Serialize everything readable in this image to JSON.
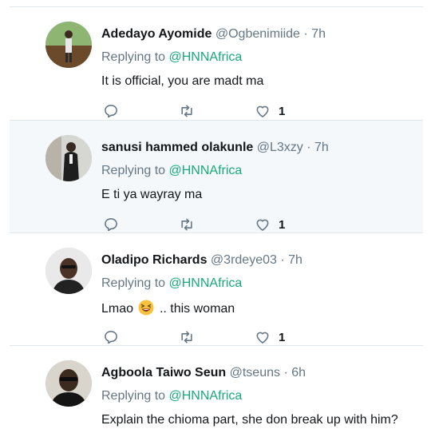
{
  "tweets": [
    {
      "name": "Adedayo Ayomide",
      "handle": "@Ogbenimiide",
      "dot": "·",
      "time": "7h",
      "replying_prefix": "Replying to",
      "replying_to": "@HNNAfrica",
      "text": "It is official, you are madt ma",
      "likes": "1",
      "highlighted": false
    },
    {
      "name": "sanusi hammed olakunle",
      "handle": "@L3xzy",
      "dot": "·",
      "time": "7h",
      "replying_prefix": "Replying to",
      "replying_to": "@HNNAfrica",
      "text": "E ti ya wayray ma",
      "likes": "1",
      "highlighted": true
    },
    {
      "name": "Oladipo Richards",
      "handle": "@3rdeye03",
      "dot": "·",
      "time": "7h",
      "replying_prefix": "Replying to",
      "replying_to": "@HNNAfrica",
      "text_before": "Lmao",
      "text_after": ".. this woman",
      "emoji": "laughing-face-emoji",
      "likes": "1",
      "highlighted": false
    },
    {
      "name": "Agboola Taiwo Seun",
      "handle": "@tseuns",
      "dot": "·",
      "time": "6h",
      "replying_prefix": "Replying to",
      "replying_to": "@HNNAfrica",
      "text": "Explain the chioma part, she don break up with him?",
      "highlighted": false
    }
  ],
  "colors": {
    "mention": "#19a97b",
    "divider": "#e1e8ed",
    "highlight_bg": "#f5f8fa",
    "secondary_text": "#657786",
    "icon": "#657786"
  },
  "icons": {
    "reply": "reply-bubble-icon",
    "retweet": "retweet-arrows-icon",
    "like": "heart-outline-icon"
  }
}
